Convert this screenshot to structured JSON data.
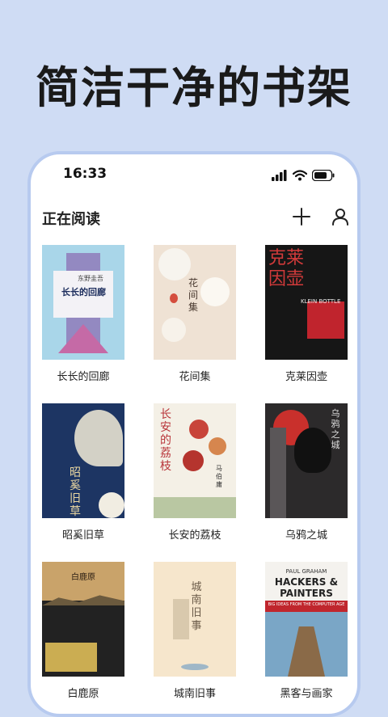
{
  "headline": "简洁干净的书架",
  "status": {
    "time": "16:33"
  },
  "header": {
    "title": "正在阅读"
  },
  "books": [
    {
      "title": "长长的回廊",
      "cover_text": "长长的回廊",
      "cover_author": "东野圭吾",
      "colors": [
        "#a9d6e9",
        "#8c6fb3"
      ]
    },
    {
      "title": "花间集",
      "cover_text": "花间集",
      "colors": [
        "#efe2d4",
        "#c9a78a"
      ]
    },
    {
      "title": "克莱因壶",
      "cover_text": "克莱因壶",
      "cover_sub": "KLEIN BOTTLE",
      "colors": [
        "#161616",
        "#c0242d"
      ]
    },
    {
      "title": "昭奚旧草",
      "cover_text": "昭奚旧草",
      "colors": [
        "#1d3563",
        "#e8e2d0"
      ]
    },
    {
      "title": "长安的荔枝",
      "cover_text": "长安的荔枝",
      "cover_author": "马伯庸",
      "colors": [
        "#f4f0e6",
        "#c8443a"
      ]
    },
    {
      "title": "乌鸦之城",
      "cover_text": "乌鸦之城",
      "colors": [
        "#2c2a2b",
        "#c9302c"
      ]
    },
    {
      "title": "白鹿原",
      "cover_text": "白鹿原",
      "colors": [
        "#c9a36a",
        "#222222"
      ]
    },
    {
      "title": "城南旧事",
      "cover_text": "城南旧事",
      "colors": [
        "#f6e6cc",
        "#8a7a64"
      ]
    },
    {
      "title": "黑客与画家",
      "cover_text": "HACKERS & PAINTERS",
      "cover_sub": "BIG IDEAS FROM THE COMPUTER AGE",
      "cover_author": "PAUL GRAHAM",
      "colors": [
        "#f4f2ee",
        "#c0262d"
      ]
    }
  ]
}
